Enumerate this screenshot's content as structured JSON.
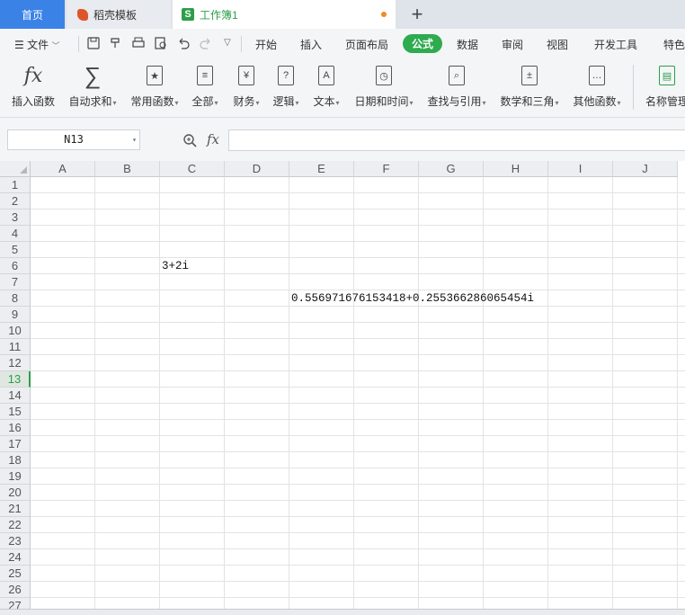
{
  "tabs": {
    "home": "首页",
    "docer": "稻壳模板",
    "workbook": "工作簿1",
    "add": "+"
  },
  "menubar": {
    "file": "文件",
    "items": [
      "开始",
      "插入",
      "页面布局",
      "公式",
      "数据",
      "审阅",
      "视图",
      "开发工具",
      "特色"
    ],
    "active": "公式"
  },
  "ribbon": {
    "insert_function": "插入函数",
    "autosum": "自动求和",
    "common": "常用函数",
    "all": "全部",
    "finance": "财务",
    "logic": "逻辑",
    "text": "文本",
    "datetime": "日期和时间",
    "lookup": "查找与引用",
    "math": "数学和三角",
    "other": "其他函数",
    "name_manager": "名称管理"
  },
  "formula_bar": {
    "name_box": "N13",
    "fx": "fx",
    "formula": ""
  },
  "grid": {
    "columns": [
      "A",
      "B",
      "C",
      "D",
      "E",
      "F",
      "G",
      "H",
      "I",
      "J"
    ],
    "rows": [
      "1",
      "2",
      "3",
      "4",
      "5",
      "6",
      "7",
      "8",
      "9",
      "10",
      "11",
      "12",
      "13",
      "14",
      "15",
      "16",
      "17",
      "18",
      "19",
      "20",
      "21",
      "22",
      "23",
      "24",
      "25",
      "26",
      "27"
    ],
    "active_row": "13",
    "cells": {
      "C6": "3+2i",
      "E8": "0.556971676153418+0.255366286065454i"
    }
  },
  "colors": {
    "accent_green": "#2eab4f",
    "home_tab_blue": "#3b82e6"
  }
}
